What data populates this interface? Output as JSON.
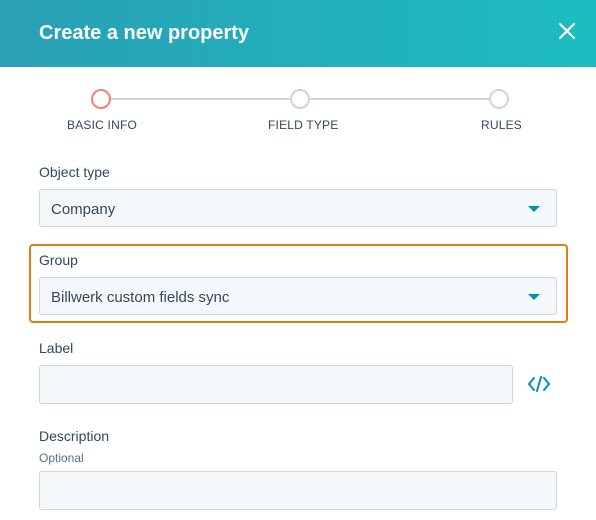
{
  "header": {
    "title": "Create a new property"
  },
  "stepper": {
    "steps": [
      {
        "label": "BASIC INFO",
        "active": true
      },
      {
        "label": "FIELD TYPE",
        "active": false
      },
      {
        "label": "RULES",
        "active": false
      }
    ]
  },
  "form": {
    "object_type": {
      "label": "Object type",
      "value": "Company"
    },
    "group": {
      "label": "Group",
      "value": "Billwerk custom fields sync"
    },
    "label_field": {
      "label": "Label",
      "value": "",
      "icon": "code-brackets-icon"
    },
    "description": {
      "label": "Description",
      "sub": "Optional",
      "value": ""
    }
  },
  "colors": {
    "header_start": "#2a9fb6",
    "header_end": "#1cbdc0",
    "active_step": "#f2826f",
    "highlight": "#e27d12",
    "caret": "#0091ae"
  }
}
